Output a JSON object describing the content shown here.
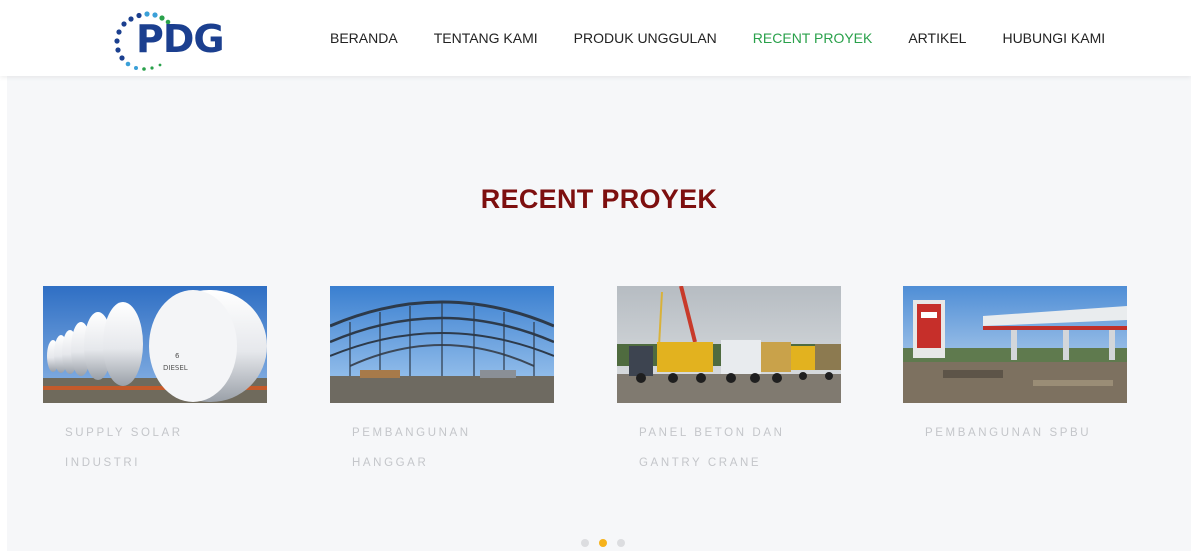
{
  "brand": {
    "logo_text": "PDG"
  },
  "nav": {
    "items": [
      {
        "label": "BERANDA"
      },
      {
        "label": "TENTANG KAMI"
      },
      {
        "label": "PRODUK UNGGULAN"
      },
      {
        "label": "RECENT PROYEK",
        "active": true
      },
      {
        "label": "ARTIKEL"
      },
      {
        "label": "HUBUNGI KAMI"
      }
    ]
  },
  "colors": {
    "accent_green": "#2aa14b",
    "title_red": "#7d0f0f",
    "dot_active": "#f6b21b",
    "logo_blue": "#1b3f8f"
  },
  "section": {
    "title": "RECENT PROYEK",
    "projects": [
      {
        "title": "SUPPLY SOLAR INDUSTRI",
        "image": "white-fuel-tanks-photo"
      },
      {
        "title": "PEMBANGUNAN HANGGAR",
        "image": "steel-hangar-roof-photo"
      },
      {
        "title": "PANEL BETON DAN GANTRY CRANE",
        "image": "cranes-and-trucks-photo"
      },
      {
        "title": "PEMBANGUNAN SPBU",
        "image": "gas-station-construction-photo"
      }
    ]
  },
  "carousel": {
    "page_count": 3,
    "active_page": 2
  }
}
